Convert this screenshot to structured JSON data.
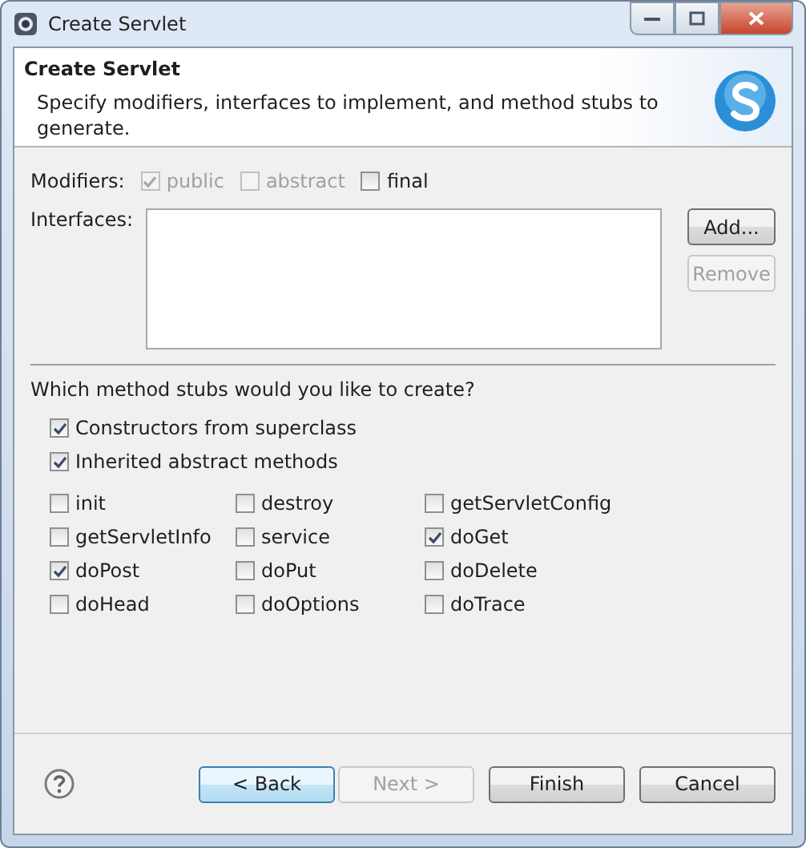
{
  "window": {
    "title": "Create Servlet"
  },
  "header": {
    "title": "Create Servlet",
    "description": "Specify modifiers, interfaces to implement, and method stubs to generate."
  },
  "modifiers": {
    "label": "Modifiers:",
    "options": [
      {
        "label": "public",
        "checked": true,
        "disabled": true
      },
      {
        "label": "abstract",
        "checked": false,
        "disabled": true
      },
      {
        "label": "final",
        "checked": false,
        "disabled": false
      }
    ]
  },
  "interfaces": {
    "label": "Interfaces:",
    "buttons": [
      {
        "label": "Add...",
        "disabled": false
      },
      {
        "label": "Remove",
        "disabled": true
      }
    ]
  },
  "stubs": {
    "question": "Which method stubs would you like to create?",
    "options": [
      {
        "label": "Constructors from superclass",
        "checked": true
      },
      {
        "label": "Inherited abstract methods",
        "checked": true
      }
    ],
    "methods": [
      {
        "label": "init",
        "checked": false
      },
      {
        "label": "destroy",
        "checked": false
      },
      {
        "label": "getServletConfig",
        "checked": false
      },
      {
        "label": "getServletInfo",
        "checked": false
      },
      {
        "label": "service",
        "checked": false
      },
      {
        "label": "doGet",
        "checked": true
      },
      {
        "label": "doPost",
        "checked": true
      },
      {
        "label": "doPut",
        "checked": false
      },
      {
        "label": "doDelete",
        "checked": false
      },
      {
        "label": "doHead",
        "checked": false
      },
      {
        "label": "doOptions",
        "checked": false
      },
      {
        "label": "doTrace",
        "checked": false
      }
    ]
  },
  "footer": {
    "buttons": [
      {
        "label": "< Back",
        "disabled": false,
        "focused": true
      },
      {
        "label": "Next >",
        "disabled": true,
        "focused": false
      },
      {
        "label": "Finish",
        "disabled": false,
        "focused": false
      },
      {
        "label": "Cancel",
        "disabled": false,
        "focused": false
      }
    ]
  }
}
